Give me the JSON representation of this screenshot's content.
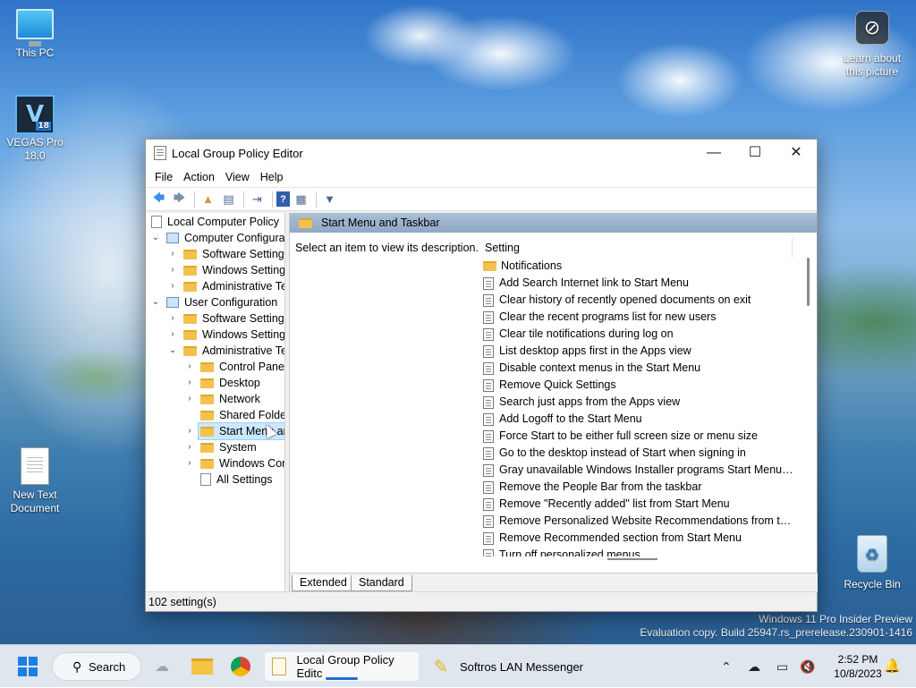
{
  "desktop": {
    "icons": {
      "this_pc": "This PC",
      "vegas_line1": "VEGAS Pro",
      "vegas_line2": "18.0",
      "vegas_letter": "V",
      "vegas_badge": "18",
      "new_text_line1": "New Text",
      "new_text_line2": "Document",
      "learn_line1": "Learn about",
      "learn_line2": "this picture",
      "recycle_bin": "Recycle Bin"
    },
    "watermark": {
      "line1": "Windows 11 Pro Insider Preview",
      "line2": "Evaluation copy. Build 25947.rs_prerelease.230901-1416"
    }
  },
  "window": {
    "title": "Local Group Policy Editor",
    "controls": {
      "minimize": "—",
      "maximize": "☐",
      "close": "✕"
    },
    "menu": [
      "File",
      "Action",
      "View",
      "Help"
    ],
    "toolbar_icons": [
      "back-arrow-icon",
      "forward-arrow-icon",
      "up-folder-icon",
      "show-hide-tree-icon",
      "export-list-icon",
      "help-icon",
      "properties-icon",
      "filter-icon"
    ],
    "tree": {
      "root": "Local Computer Policy",
      "computer_config": "Computer Configura",
      "cc_software": "Software Settings",
      "cc_windows": "Windows Setting",
      "cc_admin": "Administrative Te",
      "user_config": "User Configuration",
      "uc_software": "Software Settings",
      "uc_windows": "Windows Setting",
      "uc_admin": "Administrative Te",
      "control_panel": "Control Panel",
      "desktop": "Desktop",
      "network": "Network",
      "shared_folders": "Shared Folder",
      "start_menu": "Start Menu ar",
      "system": "System",
      "windows_components": "Windows Cor",
      "all_settings": "All Settings"
    },
    "right": {
      "header": "Start Menu and Taskbar",
      "description": "Select an item to view its description.",
      "column_setting": "Setting",
      "items": [
        {
          "type": "folder",
          "label": "Notifications"
        },
        {
          "type": "policy",
          "label": "Add Search Internet link to Start Menu"
        },
        {
          "type": "policy",
          "label": "Clear history of recently opened documents on exit"
        },
        {
          "type": "policy",
          "label": "Clear the recent programs list for new users"
        },
        {
          "type": "policy",
          "label": "Clear tile notifications during log on"
        },
        {
          "type": "policy",
          "label": "List desktop apps first in the Apps view"
        },
        {
          "type": "policy",
          "label": "Disable context menus in the Start Menu"
        },
        {
          "type": "policy",
          "label": "Remove Quick Settings"
        },
        {
          "type": "policy",
          "label": "Search just apps from the Apps view"
        },
        {
          "type": "policy",
          "label": "Add Logoff to the Start Menu"
        },
        {
          "type": "policy",
          "label": "Force Start to be either full screen size or menu size"
        },
        {
          "type": "policy",
          "label": "Go to the desktop instead of Start when signing in"
        },
        {
          "type": "policy",
          "label": "Gray unavailable Windows Installer programs Start Menu sh..."
        },
        {
          "type": "policy",
          "label": "Remove the People Bar from the taskbar"
        },
        {
          "type": "policy",
          "label": "Remove \"Recently added\" list from Start Menu"
        },
        {
          "type": "policy",
          "label": "Remove Personalized Website Recommendations from the ..."
        },
        {
          "type": "policy",
          "label": "Remove Recommended section from Start Menu"
        },
        {
          "type": "policy",
          "label": "Turn off personalized menus"
        }
      ],
      "tabs": [
        "Extended",
        "Standard"
      ]
    },
    "status": "102 setting(s)"
  },
  "taskbar": {
    "search_label": "Search",
    "apps": {
      "gpedit": "Local Group Policy Editc",
      "softros": "Softros LAN Messenger"
    },
    "clock": {
      "time": "2:52 PM",
      "date": "10/8/2023"
    },
    "accent": "#1a6fd4"
  }
}
